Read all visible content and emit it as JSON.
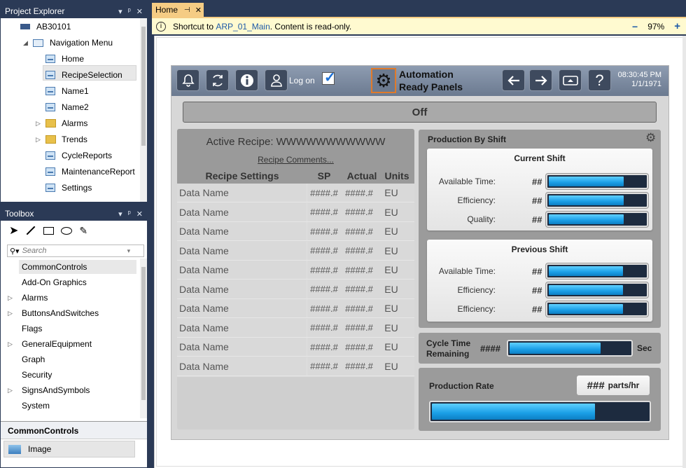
{
  "project_explorer": {
    "title": "Project Explorer",
    "items": [
      {
        "label": "AB30101",
        "type": "device"
      },
      {
        "label": "Navigation Menu",
        "type": "nav"
      },
      {
        "label": "Home",
        "type": "screen"
      },
      {
        "label": "RecipeSelection",
        "type": "screen"
      },
      {
        "label": "Name1",
        "type": "screen"
      },
      {
        "label": "Name2",
        "type": "screen"
      },
      {
        "label": "Alarms",
        "type": "folder"
      },
      {
        "label": "Trends",
        "type": "folder"
      },
      {
        "label": "CycleReports",
        "type": "screen"
      },
      {
        "label": "MaintenanceReport",
        "type": "screen"
      },
      {
        "label": "Settings",
        "type": "screen"
      }
    ]
  },
  "toolbox": {
    "title": "Toolbox",
    "search_placeholder": "Search",
    "items": [
      "CommonControls",
      "Add-On Graphics",
      "Alarms",
      "ButtonsAndSwitches",
      "Flags",
      "GeneralEquipment",
      "Graph",
      "Security",
      "SignsAndSymbols",
      "System"
    ],
    "section_title": "CommonControls",
    "section_items": [
      "Image"
    ]
  },
  "tab": {
    "label": "Home",
    "pin": "⊣",
    "close": "✕"
  },
  "info_bar": {
    "prefix": "Shortcut to ",
    "link": "ARP_01_Main",
    "suffix": ". Content is read-only.",
    "zoom": "97%",
    "minus": "−",
    "plus": "+"
  },
  "hmi": {
    "logon_label": "Log on",
    "brand_line1": "Automation",
    "brand_line2": "Ready Panels",
    "time": "08:30:45 PM",
    "date": "1/1/1971",
    "status": "Off",
    "recipe": {
      "active_label": "Active Recipe: WWWWWWWWWWW",
      "comments_link": "Recipe Comments...",
      "headers": {
        "settings": "Recipe Settings",
        "sp": "SP",
        "actual": "Actual",
        "units": "Units"
      },
      "rows": [
        {
          "name": "Data Name",
          "sp": "####.#",
          "actual": "####.#",
          "units": "EU"
        },
        {
          "name": "Data Name",
          "sp": "####.#",
          "actual": "####.#",
          "units": "EU"
        },
        {
          "name": "Data Name",
          "sp": "####.#",
          "actual": "####.#",
          "units": "EU"
        },
        {
          "name": "Data Name",
          "sp": "####.#",
          "actual": "####.#",
          "units": "EU"
        },
        {
          "name": "Data Name",
          "sp": "####.#",
          "actual": "####.#",
          "units": "EU"
        },
        {
          "name": "Data Name",
          "sp": "####.#",
          "actual": "####.#",
          "units": "EU"
        },
        {
          "name": "Data Name",
          "sp": "####.#",
          "actual": "####.#",
          "units": "EU"
        },
        {
          "name": "Data Name",
          "sp": "####.#",
          "actual": "####.#",
          "units": "EU"
        },
        {
          "name": "Data Name",
          "sp": "####.#",
          "actual": "####.#",
          "units": "EU"
        },
        {
          "name": "Data Name",
          "sp": "####.#",
          "actual": "####.#",
          "units": "EU"
        }
      ]
    },
    "production_by_shift": {
      "title": "Production By Shift",
      "current": {
        "title": "Current Shift",
        "metrics": [
          {
            "label": "Available Time:",
            "value": "##",
            "level": 0.77
          },
          {
            "label": "Efficiency:",
            "value": "##",
            "level": 0.77
          },
          {
            "label": "Quality:",
            "value": "##",
            "level": 0.77
          }
        ]
      },
      "previous": {
        "title": "Previous Shift",
        "metrics": [
          {
            "label": "Available Time:",
            "value": "##",
            "level": 0.76
          },
          {
            "label": "Efficiency:",
            "value": "##",
            "level": 0.76
          },
          {
            "label": "Efficiency:",
            "value": "##",
            "level": 0.76
          }
        ]
      }
    },
    "cycle_time": {
      "label_line1": "Cycle Time",
      "label_line2": "Remaining",
      "value": "####",
      "unit": "Sec",
      "level": 0.75
    },
    "production_rate": {
      "label": "Production Rate",
      "value": "###",
      "unit": "parts/hr",
      "level": 0.75
    }
  }
}
